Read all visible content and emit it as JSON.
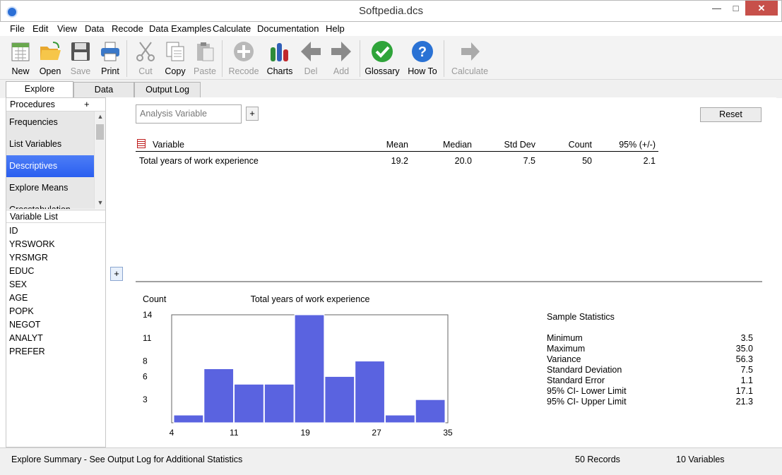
{
  "window": {
    "title": "Softpedia.dcs"
  },
  "menu": [
    "File",
    "Edit",
    "View",
    "Data",
    "Recode",
    "Data Examples",
    "Calculate",
    "Documentation",
    "Help"
  ],
  "toolbar": {
    "new": "New",
    "open": "Open",
    "save": "Save",
    "print": "Print",
    "cut": "Cut",
    "copy": "Copy",
    "paste": "Paste",
    "recode": "Recode",
    "charts": "Charts",
    "del": "Del",
    "add": "Add",
    "glossary": "Glossary",
    "howto": "How To",
    "calculate": "Calculate"
  },
  "tabs": [
    "Explore",
    "Data",
    "Output Log"
  ],
  "procedures": {
    "header": "Procedures",
    "plus": "+",
    "items": [
      "Frequencies",
      "List Variables",
      "Descriptives",
      "Explore Means",
      "Crosstabulation"
    ]
  },
  "variable_list": {
    "header": "Variable List",
    "items": [
      "ID",
      "YRSWORK",
      "YRSMGR",
      "EDUC",
      "SEX",
      "AGE",
      "POPK",
      "NEGOT",
      "ANALYT",
      "PREFER"
    ]
  },
  "analysis": {
    "placeholder": "Analysis Variable",
    "plus": "+",
    "reset": "Reset",
    "chart_plus": "+"
  },
  "results": {
    "headers": [
      "Variable",
      "Mean",
      "Median",
      "Std Dev",
      "Count",
      "95% (+/-)"
    ],
    "rows": [
      [
        "Total years of work experience",
        "19.2",
        "20.0",
        "7.5",
        "50",
        "2.1"
      ]
    ]
  },
  "chart_data": {
    "type": "bar",
    "title": "Total years of work experience",
    "ylabel": "Count",
    "xlabel": "",
    "x_ticks": [
      "4",
      "11",
      "19",
      "27",
      "35"
    ],
    "y_ticks": [
      "3",
      "6",
      "8",
      "11",
      "14"
    ],
    "bin_range": [
      4,
      35
    ],
    "values": [
      1,
      7,
      5,
      5,
      14,
      6,
      8,
      1,
      3
    ],
    "ylim": [
      0,
      14
    ],
    "bar_color": "#5a63e0"
  },
  "sample_stats": {
    "title": "Sample Statistics",
    "rows": [
      {
        "label": "Minimum",
        "value": "3.5"
      },
      {
        "label": "Maximum",
        "value": "35.0"
      },
      {
        "label": "Variance",
        "value": "56.3"
      },
      {
        "label": "Standard Deviation",
        "value": "7.5"
      },
      {
        "label": "Standard Error",
        "value": "1.1"
      },
      {
        "label": "95% CI- Lower Limit",
        "value": "17.1"
      },
      {
        "label": "95% CI- Upper Limit",
        "value": "21.3"
      }
    ]
  },
  "status": {
    "summary": "Explore Summary  -  See Output Log for Additional Statistics",
    "records": "50 Records",
    "variables": "10 Variables"
  }
}
